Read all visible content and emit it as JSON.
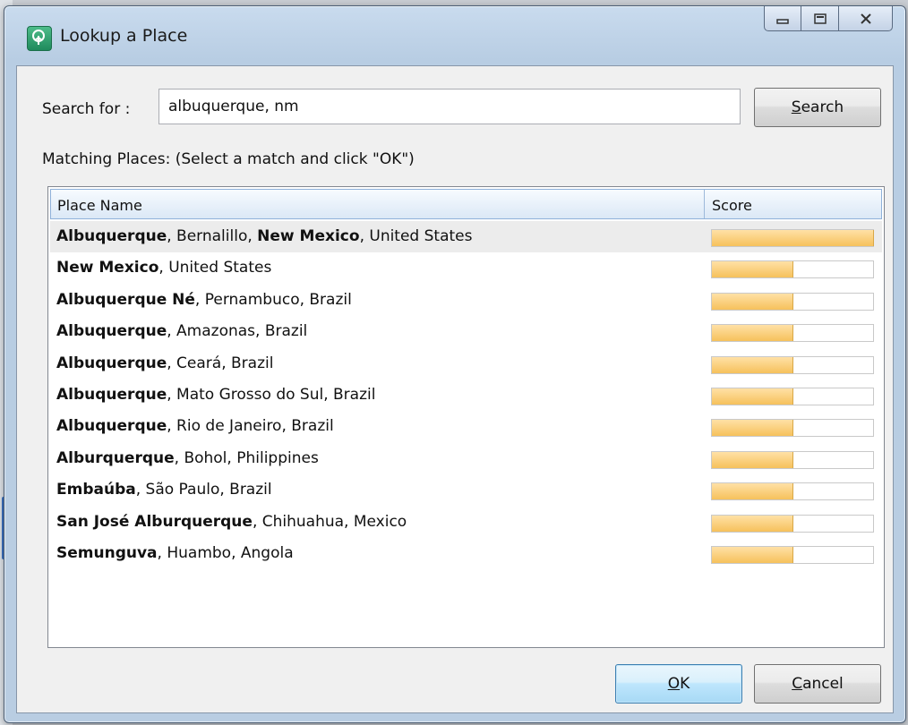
{
  "window": {
    "title": "Lookup a Place"
  },
  "search": {
    "label": "Search for :",
    "value": "albuquerque, nm",
    "button_prefix": "",
    "button_mnemonic": "S",
    "button_rest": "earch"
  },
  "matching_label": "Matching Places: (Select a match and click \"OK\")",
  "list": {
    "columns": [
      "Place Name",
      "Score"
    ],
    "selected_index": 0,
    "rows": [
      {
        "segments": [
          {
            "t": "Albuquerque",
            "b": true
          },
          {
            "t": ", Bernalillo, ",
            "b": false
          },
          {
            "t": "New Mexico",
            "b": true
          },
          {
            "t": ", United States",
            "b": false
          }
        ],
        "score": 1.0
      },
      {
        "segments": [
          {
            "t": "New Mexico",
            "b": true
          },
          {
            "t": ", United States",
            "b": false
          }
        ],
        "score": 0.5
      },
      {
        "segments": [
          {
            "t": "Albuquerque Né",
            "b": true
          },
          {
            "t": ", Pernambuco, Brazil",
            "b": false
          }
        ],
        "score": 0.5
      },
      {
        "segments": [
          {
            "t": "Albuquerque",
            "b": true
          },
          {
            "t": ", Amazonas, Brazil",
            "b": false
          }
        ],
        "score": 0.5
      },
      {
        "segments": [
          {
            "t": "Albuquerque",
            "b": true
          },
          {
            "t": ", Ceará, Brazil",
            "b": false
          }
        ],
        "score": 0.5
      },
      {
        "segments": [
          {
            "t": "Albuquerque",
            "b": true
          },
          {
            "t": ", Mato Grosso do Sul, Brazil",
            "b": false
          }
        ],
        "score": 0.5
      },
      {
        "segments": [
          {
            "t": "Albuquerque",
            "b": true
          },
          {
            "t": ", Rio de Janeiro, Brazil",
            "b": false
          }
        ],
        "score": 0.5
      },
      {
        "segments": [
          {
            "t": "Alburquerque",
            "b": true
          },
          {
            "t": ", Bohol, Philippines",
            "b": false
          }
        ],
        "score": 0.5
      },
      {
        "segments": [
          {
            "t": "Embaúba",
            "b": true
          },
          {
            "t": ", São Paulo, Brazil",
            "b": false
          }
        ],
        "score": 0.5
      },
      {
        "segments": [
          {
            "t": "San José Alburquerque",
            "b": true
          },
          {
            "t": ", Chihuahua, Mexico",
            "b": false
          }
        ],
        "score": 0.5
      },
      {
        "segments": [
          {
            "t": "Semunguva",
            "b": true
          },
          {
            "t": ", Huambo, Angola",
            "b": false
          }
        ],
        "score": 0.5
      }
    ]
  },
  "buttons": {
    "ok_mnemonic": "O",
    "ok_rest": "K",
    "cancel_mnemonic": "C",
    "cancel_rest": "ancel"
  },
  "icons": {
    "app": "app-tree-icon",
    "minimize": "minimize-icon",
    "maximize": "maximize-icon",
    "close": "close-icon"
  },
  "colors": {
    "score_fill": "#f6c15c",
    "header_border": "#8fb1d9",
    "ok_border": "#3c7fb1"
  }
}
